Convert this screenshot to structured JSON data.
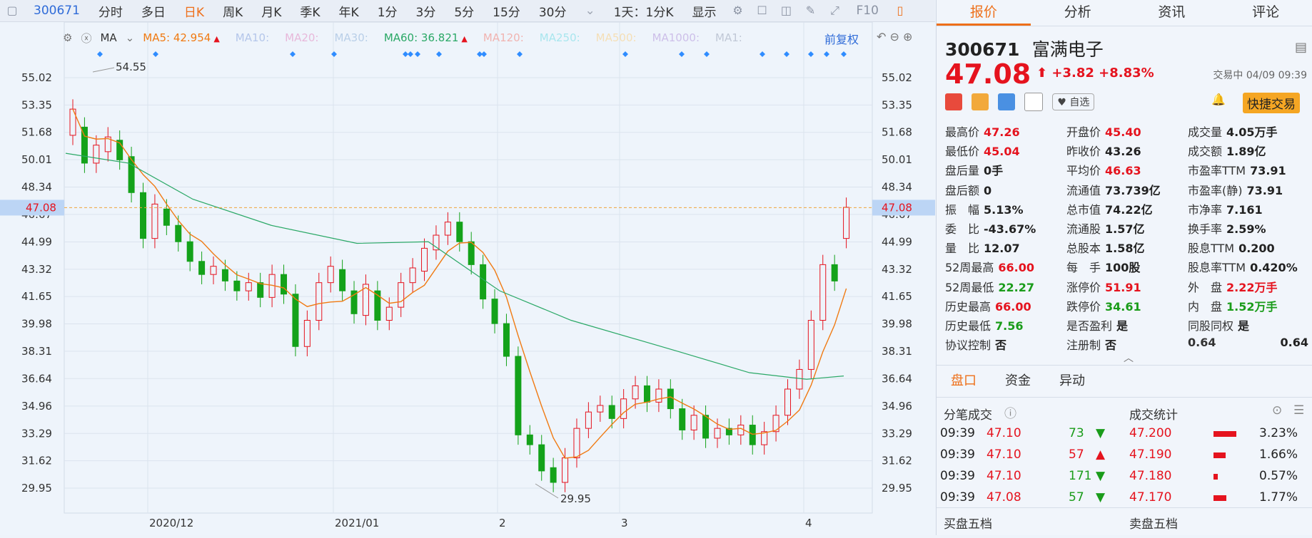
{
  "toolbar": {
    "code": "300671",
    "periods": [
      "分时",
      "多日",
      "日K",
      "周K",
      "月K",
      "季K",
      "年K",
      "1分",
      "3分",
      "5分",
      "15分",
      "30分"
    ],
    "active_period": "日K",
    "dropdown": "1天：1分K",
    "display": "显示",
    "f10": "F10"
  },
  "indicator": {
    "ma_label": "MA",
    "items": [
      {
        "label": "MA5: 42.954",
        "color": "#f07a12",
        "arrow": "▲"
      },
      {
        "label": "MA10:",
        "color": "#b4c6ea"
      },
      {
        "label": "MA20:",
        "color": "#e7b8da"
      },
      {
        "label": "MA30:",
        "color": "#b9cfe8"
      },
      {
        "label": "MA60: 36.821",
        "color": "#2aa866",
        "arrow": "▲"
      },
      {
        "label": "MA120:",
        "color": "#f1b3b0"
      },
      {
        "label": "MA250:",
        "color": "#a8e6ee"
      },
      {
        "label": "MA500:",
        "color": "#f5dfb6"
      },
      {
        "label": "MA1000:",
        "color": "#cdbfe9"
      },
      {
        "label": "MA1:",
        "color": "#c0c8d6"
      }
    ],
    "restore": "前复权"
  },
  "chart_data": {
    "type": "candlestick",
    "y_ticks": [
      "55.02",
      "53.35",
      "51.68",
      "50.01",
      "48.34",
      "46.67",
      "44.99",
      "43.32",
      "41.65",
      "39.98",
      "38.31",
      "36.64",
      "34.96",
      "33.29",
      "31.62",
      "29.95"
    ],
    "current_price_label": "47.08",
    "x_labels": [
      "2020/12",
      "2021/01",
      "2",
      "3",
      "4"
    ],
    "annotations": {
      "high": "54.55",
      "low": "29.95"
    }
  },
  "quote": {
    "code": "300671",
    "name": "富满电子",
    "price": "47.08",
    "change": "+3.82",
    "change_pct": "+8.83%",
    "status": "交易中 04/09 09:39",
    "watch_label": "自选",
    "quick_trade": "快捷交易"
  },
  "tabs": [
    "报价",
    "分析",
    "资讯",
    "评论"
  ],
  "stats": [
    [
      {
        "l": "最高价",
        "v": "47.26",
        "c": "red"
      },
      {
        "l": "开盘价",
        "v": "45.40",
        "c": "red"
      },
      {
        "l": "成交量",
        "v": "4.05万手",
        "c": "blk"
      }
    ],
    [
      {
        "l": "最低价",
        "v": "45.04",
        "c": "red"
      },
      {
        "l": "昨收价",
        "v": "43.26",
        "c": "blk"
      },
      {
        "l": "成交额",
        "v": "1.89亿",
        "c": "blk"
      }
    ],
    [
      {
        "l": "盘后量",
        "v": "0手",
        "c": "blk"
      },
      {
        "l": "平均价",
        "v": "46.63",
        "c": "red"
      },
      {
        "l": "市盈率TTM",
        "v": "73.91",
        "c": "blk"
      }
    ],
    [
      {
        "l": "盘后额",
        "v": "0",
        "c": "blk"
      },
      {
        "l": "流通值",
        "v": "73.739亿",
        "c": "blk"
      },
      {
        "l": "市盈率(静)",
        "v": "73.91",
        "c": "blk"
      }
    ],
    [
      {
        "l": "振　幅",
        "v": "5.13%",
        "c": "blk"
      },
      {
        "l": "总市值",
        "v": "74.22亿",
        "c": "blk"
      },
      {
        "l": "市净率",
        "v": "7.161",
        "c": "blk"
      }
    ],
    [
      {
        "l": "委　比",
        "v": "-43.67%",
        "c": "blk"
      },
      {
        "l": "流通股",
        "v": "1.57亿",
        "c": "blk"
      },
      {
        "l": "换手率",
        "v": "2.59%",
        "c": "blk"
      }
    ],
    [
      {
        "l": "量　比",
        "v": "12.07",
        "c": "blk"
      },
      {
        "l": "总股本",
        "v": "1.58亿",
        "c": "blk"
      },
      {
        "l": "股息TTM",
        "v": "0.200",
        "c": "blk"
      }
    ],
    [
      {
        "l": "52周最高",
        "v": "66.00",
        "c": "red"
      },
      {
        "l": "每　手",
        "v": "100股",
        "c": "blk"
      },
      {
        "l": "股息率TTM",
        "v": "0.420%",
        "c": "blk"
      }
    ],
    [
      {
        "l": "52周最低",
        "v": "22.27",
        "c": "green"
      },
      {
        "l": "涨停价",
        "v": "51.91",
        "c": "red"
      },
      {
        "l": "外　盘",
        "v": "2.22万手",
        "c": "red"
      }
    ],
    [
      {
        "l": "历史最高",
        "v": "66.00",
        "c": "red"
      },
      {
        "l": "跌停价",
        "v": "34.61",
        "c": "green"
      },
      {
        "l": "内　盘",
        "v": "1.52万手",
        "c": "green"
      }
    ],
    [
      {
        "l": "历史最低",
        "v": "7.56",
        "c": "green"
      },
      {
        "l": "是否盈利",
        "v": "是",
        "c": "blk"
      },
      {
        "l": "同股同权",
        "v": "是",
        "c": "blk"
      }
    ],
    [
      {
        "l": "协议控制",
        "v": "否",
        "c": "blk"
      },
      {
        "l": "注册制",
        "v": "否",
        "c": "blk"
      },
      {
        "l": "0.64",
        "v": "0.64",
        "c": "blk"
      }
    ]
  ],
  "sect2": [
    "盘口",
    "资金",
    "异动"
  ],
  "ticks": [
    {
      "t": "09:39",
      "p": "47.10",
      "q": "73",
      "d": "▼",
      "c": "green"
    },
    {
      "t": "09:39",
      "p": "47.10",
      "q": "57",
      "d": "▲",
      "c": "red"
    },
    {
      "t": "09:39",
      "p": "47.10",
      "q": "171",
      "d": "▼",
      "c": "green"
    },
    {
      "t": "09:39",
      "p": "47.08",
      "q": "57",
      "d": "▼",
      "c": "green"
    }
  ],
  "tick_header": "分笔成交",
  "dist_header": "成交统计",
  "dist": [
    {
      "p": "47.200",
      "pct": "3.23%"
    },
    {
      "p": "47.190",
      "pct": "1.66%"
    },
    {
      "p": "47.180",
      "pct": "0.57%"
    },
    {
      "p": "47.170",
      "pct": "1.77%"
    }
  ],
  "buy5": "买盘五档",
  "sell5": "卖盘五档"
}
